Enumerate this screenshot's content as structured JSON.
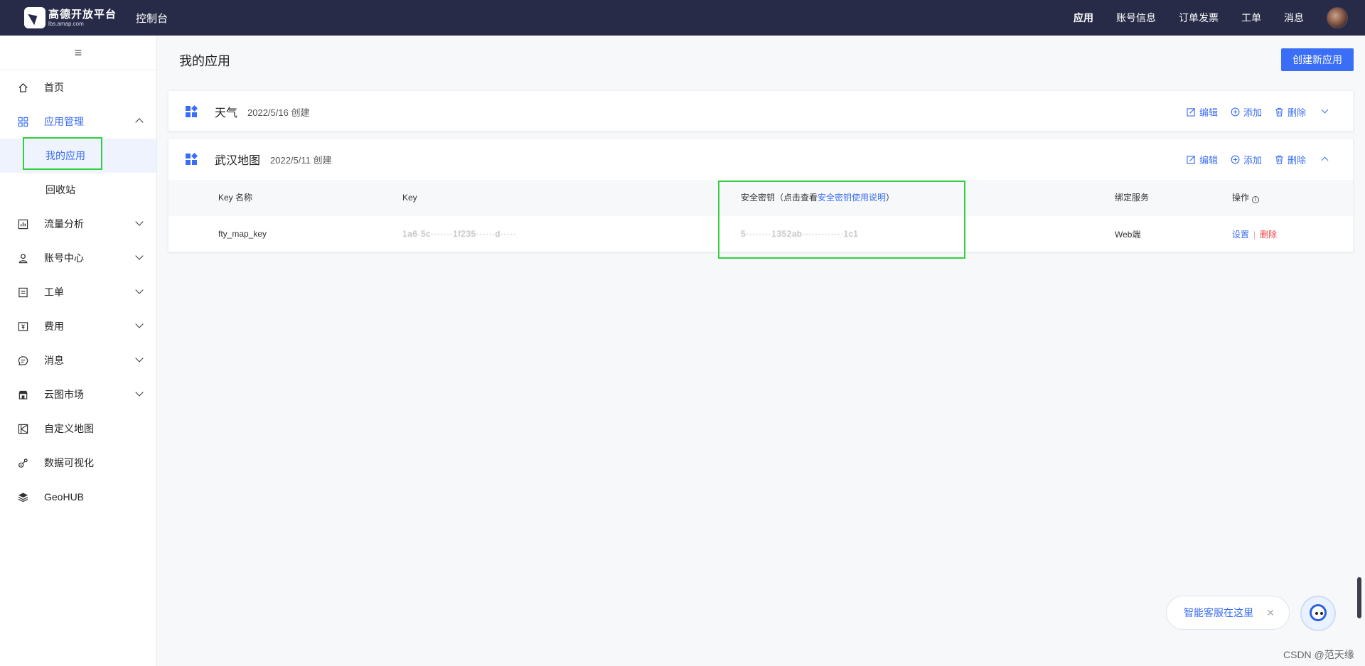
{
  "topbar": {
    "logo_cn": "高德开放平台",
    "logo_en": "lbs.amap.com",
    "console": "控制台",
    "nav": [
      "应用",
      "账号信息",
      "订单发票",
      "工单",
      "消息"
    ]
  },
  "sidebar": {
    "collapse_glyph": "≡",
    "items": [
      {
        "label": "首页"
      },
      {
        "label": "应用管理"
      },
      {
        "label": "我的应用"
      },
      {
        "label": "回收站"
      },
      {
        "label": "流量分析"
      },
      {
        "label": "账号中心"
      },
      {
        "label": "工单"
      },
      {
        "label": "费用"
      },
      {
        "label": "消息"
      },
      {
        "label": "云图市场"
      },
      {
        "label": "自定义地图"
      },
      {
        "label": "数据可视化"
      },
      {
        "label": "GeoHUB"
      }
    ]
  },
  "main": {
    "title": "我的应用",
    "create_button": "创建新应用",
    "actions": {
      "edit": "编辑",
      "add": "添加",
      "delete": "删除"
    },
    "apps": [
      {
        "name": "天气",
        "date": "2022/5/16 创建"
      },
      {
        "name": "武汉地图",
        "date": "2022/5/11 创建"
      }
    ],
    "table": {
      "headers": {
        "key_name": "Key 名称",
        "key": "Key",
        "secret_prefix": "安全密钥（点击查看",
        "secret_link": "安全密钥使用说明",
        "secret_suffix": "）",
        "service": "绑定服务",
        "ops": "操作",
        "info": "i"
      },
      "row": {
        "key_name": "fty_map_key",
        "key_masked": "1a6·5c·······1f235······d·····",
        "secret_masked": "5········1352ab·············1c1",
        "service": "Web端",
        "setting": "设置",
        "sep": "|",
        "delete": "删除"
      }
    }
  },
  "chat": {
    "label": "智能客服在这里",
    "close": "✕"
  },
  "watermark": "CSDN @范天缘",
  "colors": {
    "primary": "#3b6ef6",
    "topbar": "#272b47",
    "danger": "#f2464b",
    "highlight": "#31d03e"
  }
}
